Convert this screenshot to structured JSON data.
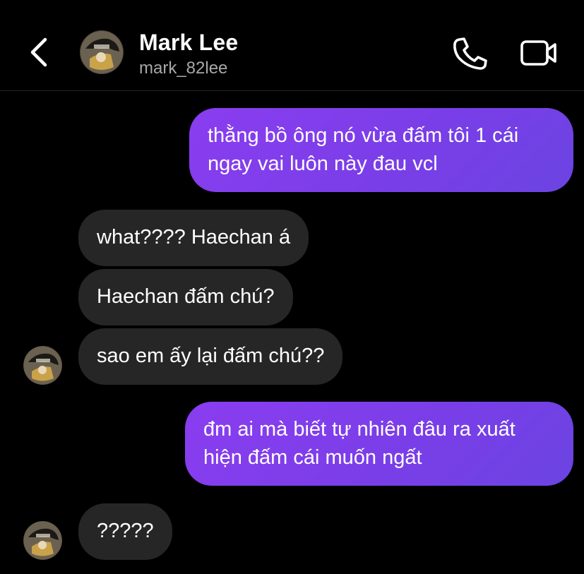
{
  "header": {
    "contact_name": "Mark Lee",
    "contact_handle": "mark_82lee",
    "back_icon": "chevron-left-icon",
    "call_icon": "phone-icon",
    "video_icon": "video-camera-icon"
  },
  "messages": [
    {
      "direction": "outgoing",
      "text": "thằng bồ ông nó vừa đấm tôi 1 cái ngay vai luôn này đau vcl"
    },
    {
      "direction": "incoming",
      "text": "what???? Haechan á"
    },
    {
      "direction": "incoming",
      "text": "Haechan đấm chú?"
    },
    {
      "direction": "incoming",
      "text": "sao em ấy lại đấm chú??"
    },
    {
      "direction": "outgoing",
      "text": "đm ai mà biết tự nhiên đâu ra xuất hiện đấm cái muốn ngất"
    },
    {
      "direction": "incoming",
      "text": "?????"
    }
  ],
  "colors": {
    "background": "#000000",
    "incoming_bubble": "#262626",
    "outgoing_bubble_start": "#8a3df0",
    "outgoing_bubble_end": "#6b44e2",
    "secondary_text": "#a8a8a8"
  }
}
